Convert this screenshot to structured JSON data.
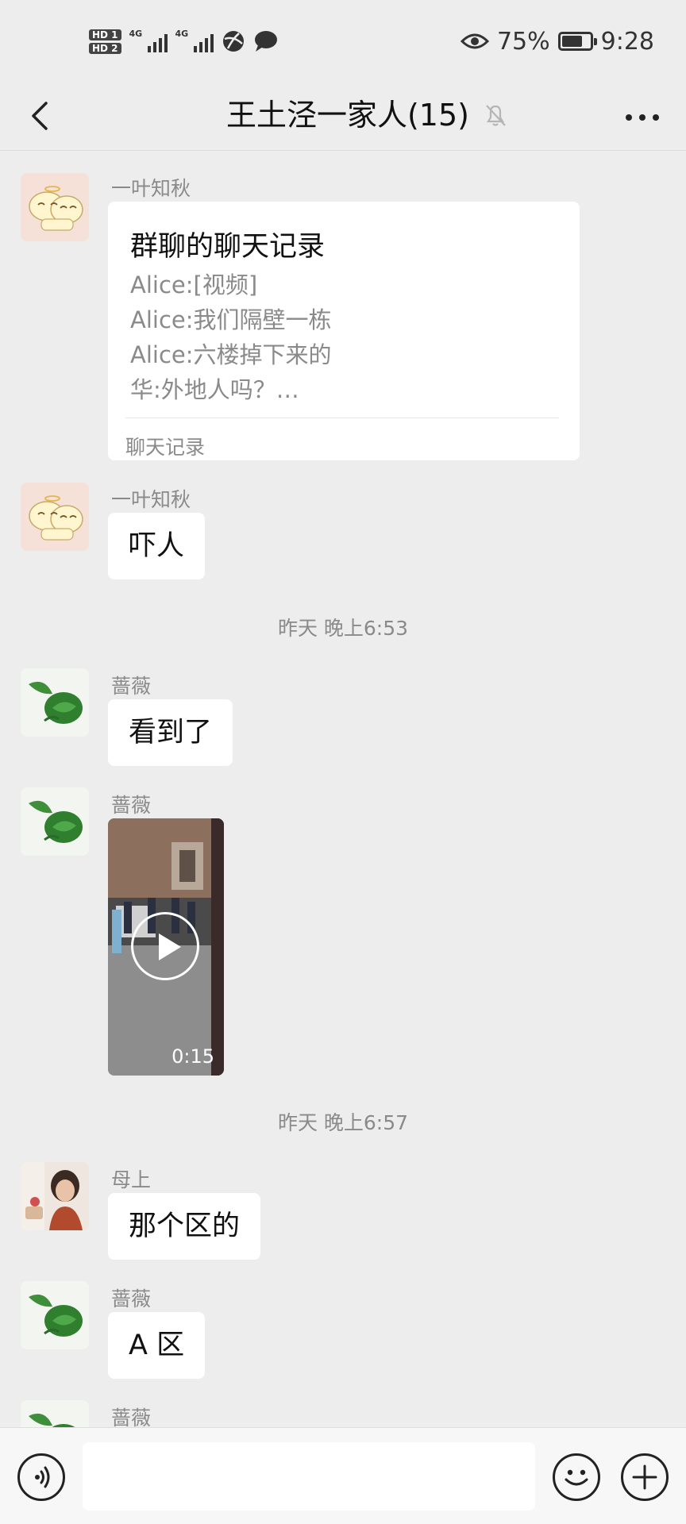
{
  "status_bar": {
    "hd1": "HD 1",
    "hd2": "HD 2",
    "net1": "4G",
    "net2": "4G",
    "battery_percent": "75%",
    "battery_level": 0.75,
    "time": "9:28"
  },
  "header": {
    "title": "王土泾一家人(15)",
    "muted": true
  },
  "messages": [
    {
      "sender": "一叶知秋",
      "type": "chat_history_card",
      "card_title": "群聊的聊天记录",
      "lines": [
        "Alice:[视频]",
        "Alice:我们隔壁一栋",
        "Alice:六楼掉下来的",
        "华:外地人吗？…"
      ],
      "footer": "聊天记录"
    },
    {
      "sender": "一叶知秋",
      "type": "text",
      "text": "吓人"
    },
    {
      "type": "timestamp",
      "text": "昨天 晚上6:53"
    },
    {
      "sender": "蔷薇",
      "type": "text",
      "text": "看到了"
    },
    {
      "sender": "蔷薇",
      "type": "video",
      "duration": "0:15"
    },
    {
      "type": "timestamp",
      "text": "昨天 晚上6:57"
    },
    {
      "sender": "母上",
      "type": "text",
      "text": "那个区的"
    },
    {
      "sender": "蔷薇",
      "type": "text",
      "text": "A 区"
    },
    {
      "sender": "蔷薇",
      "type": "partial"
    }
  ],
  "input": {
    "placeholder": ""
  },
  "colors": {
    "background": "#ededed",
    "bubble": "#ffffff",
    "meta_text": "#8a8a8a"
  }
}
